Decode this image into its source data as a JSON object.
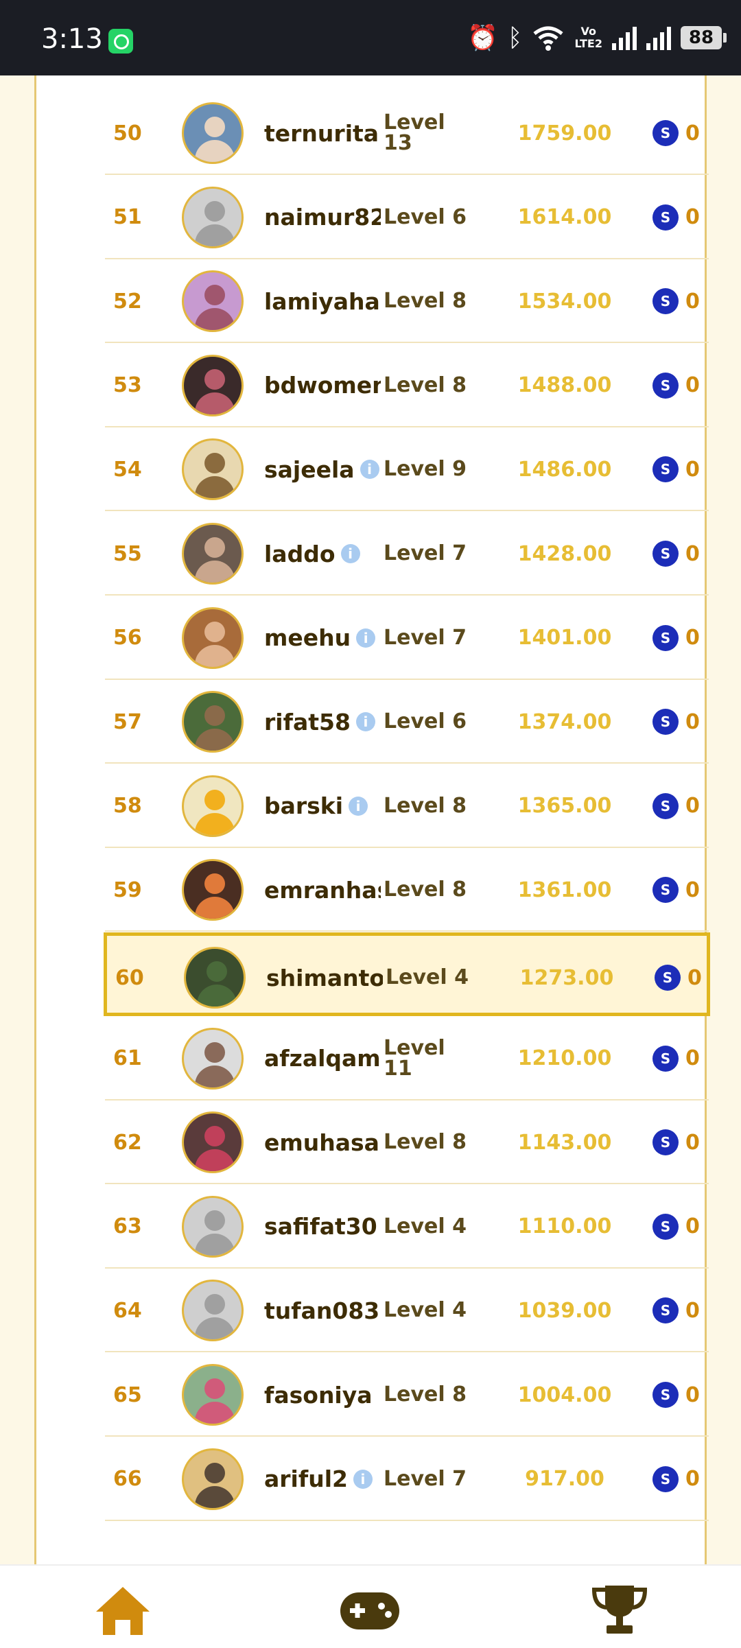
{
  "status_bar": {
    "time": "3:13",
    "battery": "88",
    "volte_line1": "Vo",
    "volte_line2": "LTE2"
  },
  "colors": {
    "accent": "#e0b61f",
    "rank": "#d08b0e",
    "points": "#e7bd34",
    "coin": "#1c2db8",
    "nav": "#d08b0e",
    "background": "#fdf8e6"
  },
  "leaderboard": {
    "rows": [
      {
        "rank": "50",
        "user": "ternurita",
        "level": "Level 13",
        "points": "1759.00",
        "coins": "0",
        "info": false,
        "avatar": "photo"
      },
      {
        "rank": "51",
        "user": "naimur82",
        "level": "Level 6",
        "points": "1614.00",
        "coins": "0",
        "info": false,
        "avatar": "default"
      },
      {
        "rank": "52",
        "user": "lamiyaha",
        "level": "Level 8",
        "points": "1534.00",
        "coins": "0",
        "info": false,
        "avatar": "photo"
      },
      {
        "rank": "53",
        "user": "bdwomen",
        "level": "Level 8",
        "points": "1488.00",
        "coins": "0",
        "info": false,
        "avatar": "photo"
      },
      {
        "rank": "54",
        "user": "sajeela",
        "level": "Level 9",
        "points": "1486.00",
        "coins": "0",
        "info": true,
        "avatar": "photo"
      },
      {
        "rank": "55",
        "user": "laddo",
        "level": "Level 7",
        "points": "1428.00",
        "coins": "0",
        "info": true,
        "avatar": "photo"
      },
      {
        "rank": "56",
        "user": "meehu",
        "level": "Level 7",
        "points": "1401.00",
        "coins": "0",
        "info": true,
        "avatar": "photo"
      },
      {
        "rank": "57",
        "user": "rifat58",
        "level": "Level 6",
        "points": "1374.00",
        "coins": "0",
        "info": true,
        "avatar": "photo"
      },
      {
        "rank": "58",
        "user": "barski",
        "level": "Level 8",
        "points": "1365.00",
        "coins": "0",
        "info": true,
        "avatar": "photo"
      },
      {
        "rank": "59",
        "user": "emranhas",
        "level": "Level 8",
        "points": "1361.00",
        "coins": "0",
        "info": false,
        "avatar": "photo"
      },
      {
        "rank": "60",
        "user": "shimanto",
        "level": "Level 4",
        "points": "1273.00",
        "coins": "0",
        "info": false,
        "avatar": "photo",
        "highlight": true
      },
      {
        "rank": "61",
        "user": "afzalqam",
        "level": "Level 11",
        "points": "1210.00",
        "coins": "0",
        "info": false,
        "avatar": "photo"
      },
      {
        "rank": "62",
        "user": "emuhasan",
        "level": "Level 8",
        "points": "1143.00",
        "coins": "0",
        "info": false,
        "avatar": "photo"
      },
      {
        "rank": "63",
        "user": "safifat30",
        "level": "Level 4",
        "points": "1110.00",
        "coins": "0",
        "info": false,
        "avatar": "default"
      },
      {
        "rank": "64",
        "user": "tufan083",
        "level": "Level 4",
        "points": "1039.00",
        "coins": "0",
        "info": false,
        "avatar": "default"
      },
      {
        "rank": "65",
        "user": "fasoniya",
        "level": "Level 8",
        "points": "1004.00",
        "coins": "0",
        "info": false,
        "avatar": "photo"
      },
      {
        "rank": "66",
        "user": "ariful2",
        "level": "Level 7",
        "points": "917.00",
        "coins": "0",
        "info": true,
        "avatar": "photo"
      }
    ]
  },
  "bottom_nav": {
    "items": [
      {
        "icon": "home-icon"
      },
      {
        "icon": "gamepad-icon"
      },
      {
        "icon": "trophy-icon"
      }
    ]
  }
}
